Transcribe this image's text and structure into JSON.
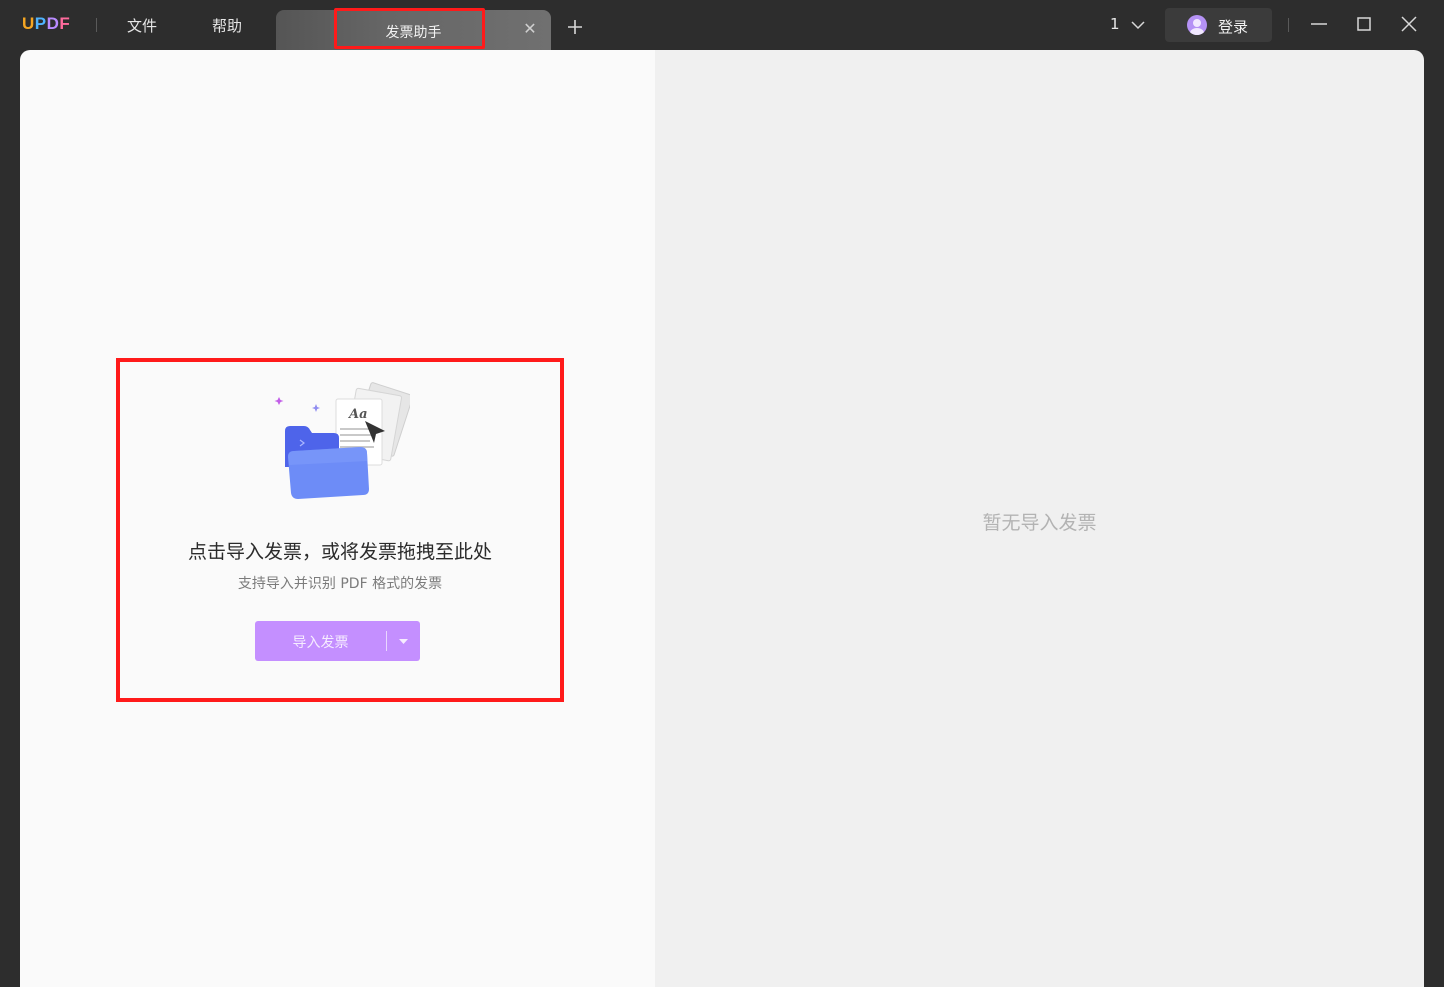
{
  "app": {
    "logo": "UPDF"
  },
  "menu": {
    "file": "文件",
    "help": "帮助"
  },
  "tab": {
    "title": "发票助手",
    "close_symbol": "✕"
  },
  "header": {
    "page_number": "1",
    "login_label": "登录"
  },
  "drop_zone": {
    "title": "点击导入发票，或将发票拖拽至此处",
    "subtitle": "支持导入并识别 PDF 格式的发票",
    "button_label": "导入发票"
  },
  "preview": {
    "empty_text": "暂无导入发票"
  },
  "colors": {
    "titlebar_bg": "#2d2d2d",
    "accent_purple": "#c48fff",
    "highlight_red": "#ff1a1a",
    "folder_blue": "#5b7cf6"
  },
  "icons": [
    "updf-logo",
    "close-icon",
    "plus-icon",
    "chevron-down-icon",
    "user-avatar-icon",
    "minimize-icon",
    "maximize-icon",
    "window-close-icon",
    "folder-documents-illustration",
    "caret-down-icon"
  ]
}
